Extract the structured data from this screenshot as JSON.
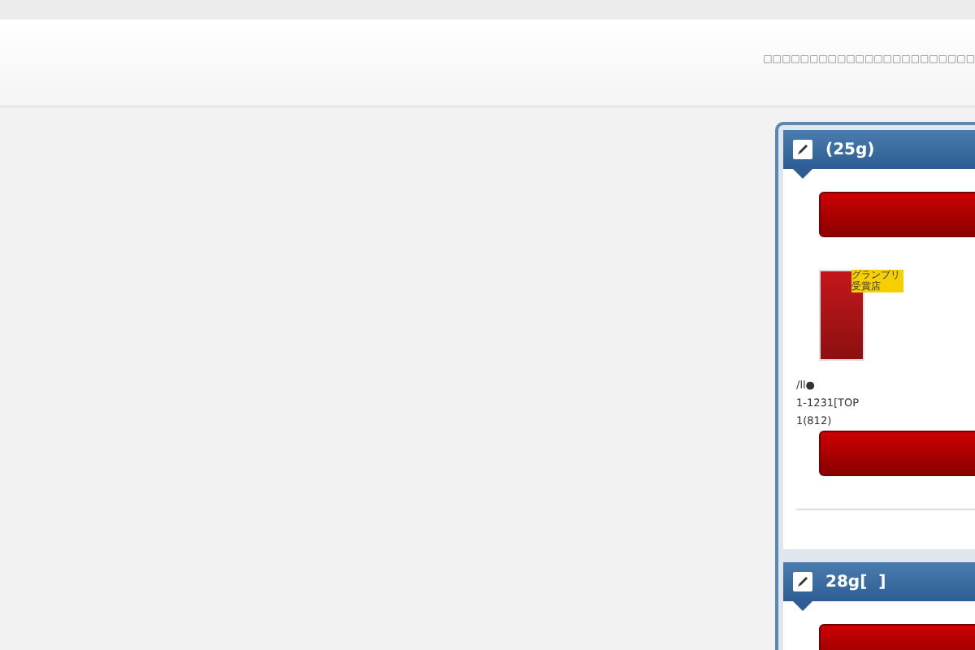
{
  "header": {
    "tagline": "□□□□□□□□□□□□□□□□□□□□□□□"
  },
  "widgets": [
    {
      "title": "(25g)",
      "items": [
        {
          "kind": "button"
        },
        {
          "kind": "product",
          "badge": "グランプリ受賞店",
          "lines": [
            "/ll●",
            "1-1231[TOP",
            "1(812)"
          ]
        },
        {
          "kind": "button"
        },
        {
          "kind": "rule"
        }
      ]
    },
    {
      "title": "28g[  ]",
      "items": [
        {
          "kind": "button"
        }
      ]
    }
  ]
}
